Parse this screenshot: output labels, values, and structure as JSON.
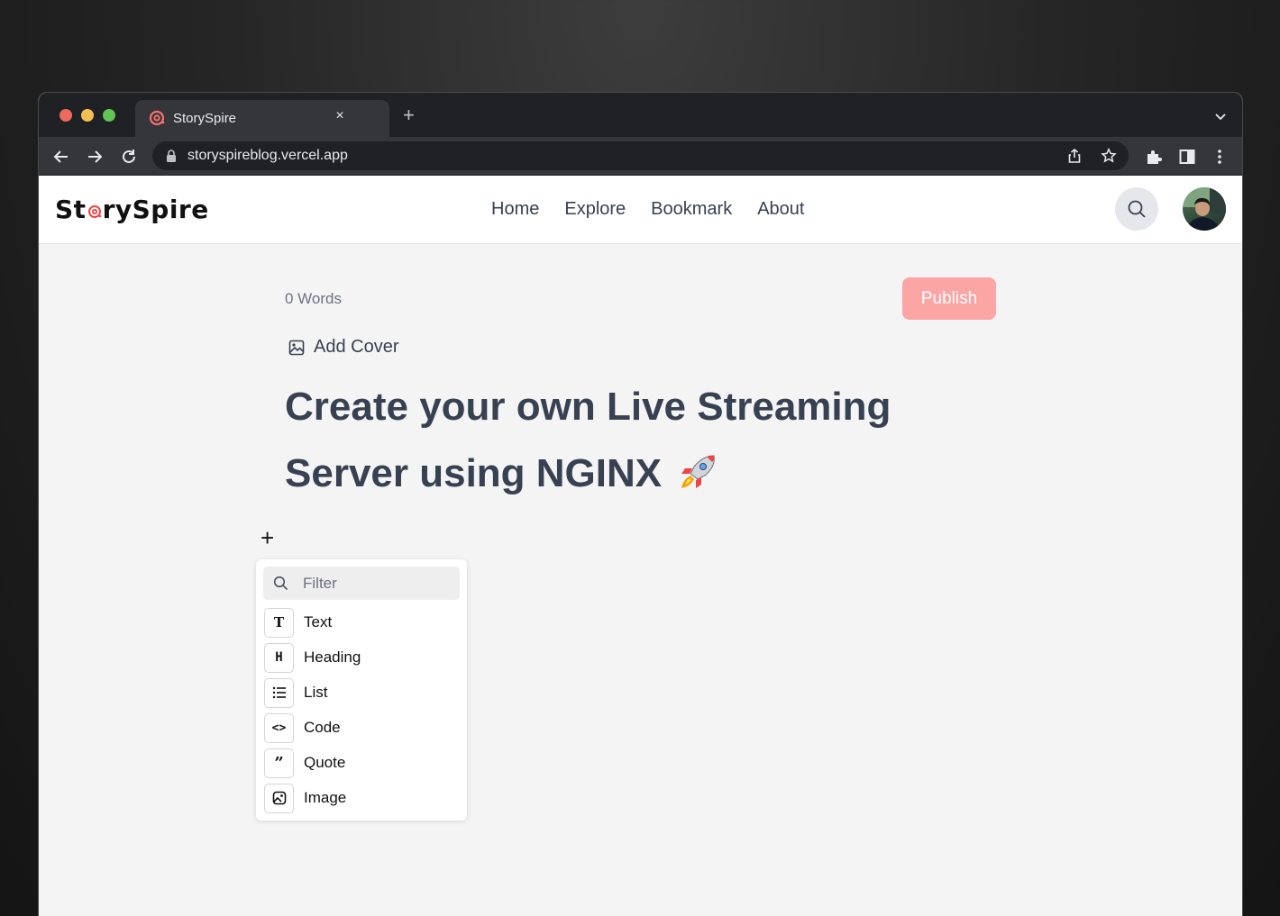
{
  "browser": {
    "tab_title": "StorySpire",
    "tab_close": "×",
    "new_tab": "+",
    "url": "storyspireblog.vercel.app"
  },
  "site": {
    "logo_prefix": "St",
    "logo_suffix": "rySpire",
    "nav": [
      "Home",
      "Explore",
      "Bookmark",
      "About"
    ],
    "accent": "#ef4444"
  },
  "editor": {
    "word_count": "0 Words",
    "publish_label": "Publish",
    "add_cover_label": "Add Cover",
    "title_text": "Create your own Live Streaming Server using NGINX",
    "block_handle": "+"
  },
  "block_menu": {
    "filter_placeholder": "Filter",
    "items": [
      {
        "label": "Text",
        "icon": "text-icon",
        "glyph": "T"
      },
      {
        "label": "Heading",
        "icon": "heading-icon",
        "glyph": "H"
      },
      {
        "label": "List",
        "icon": "list-icon"
      },
      {
        "label": "Code",
        "icon": "code-icon",
        "glyph": "<>"
      },
      {
        "label": "Quote",
        "icon": "quote-icon",
        "glyph": "”"
      },
      {
        "label": "Image",
        "icon": "image-icon"
      }
    ]
  }
}
